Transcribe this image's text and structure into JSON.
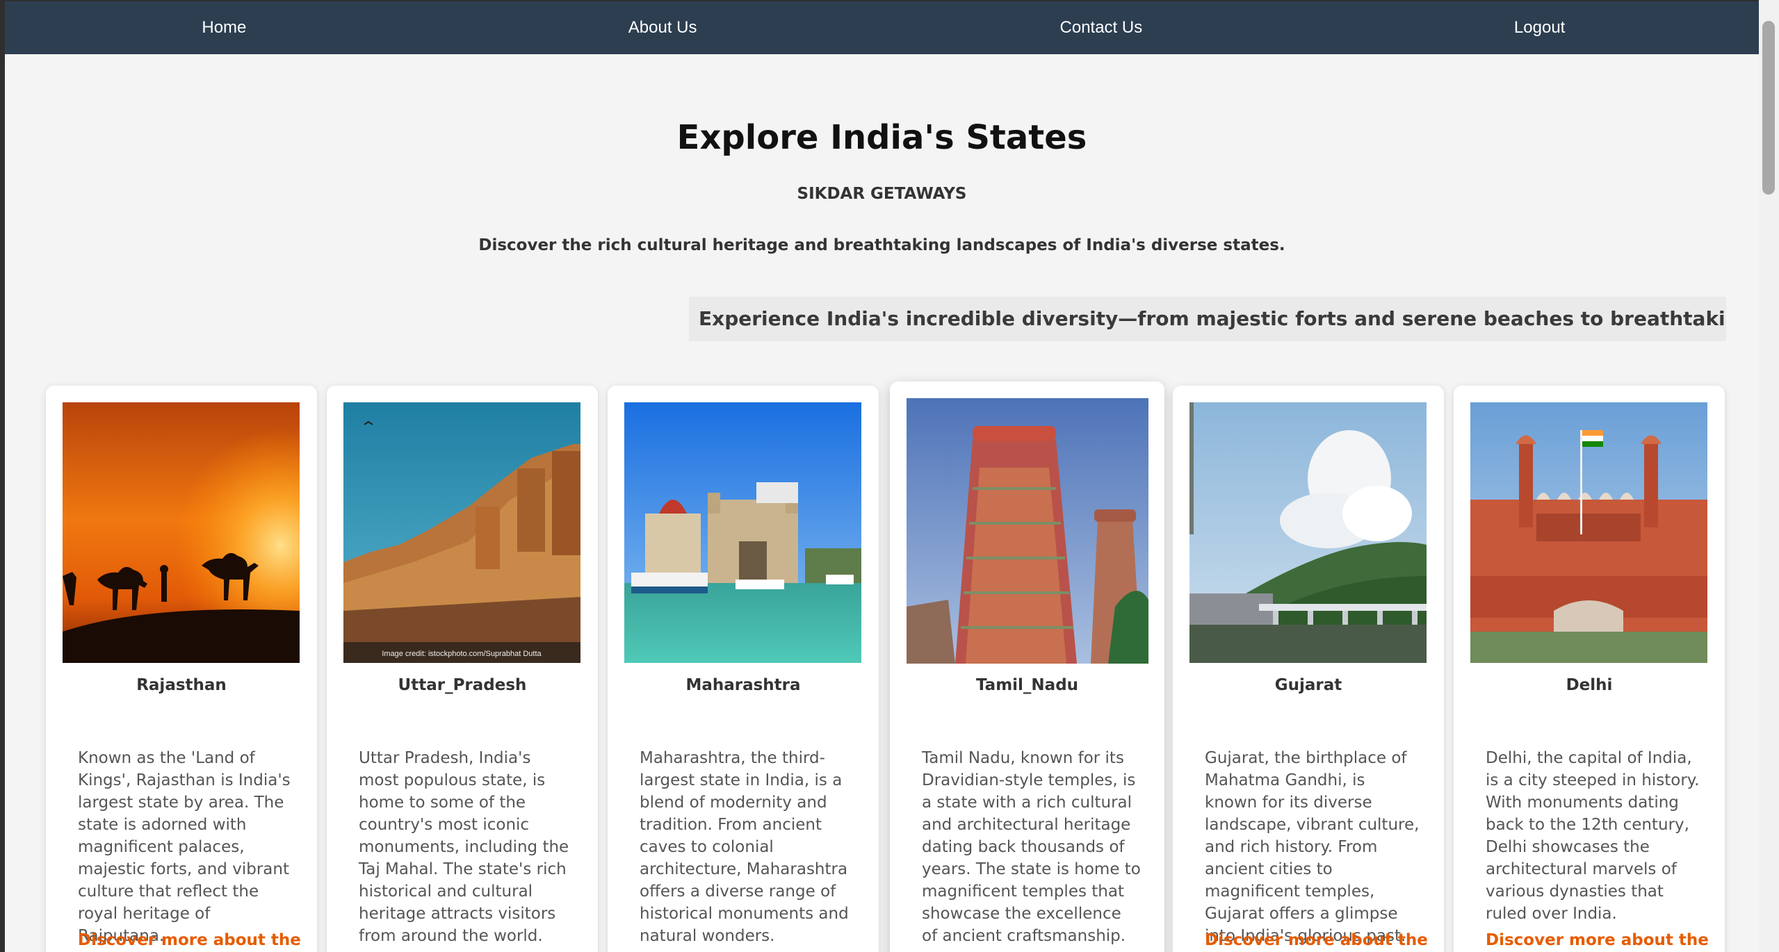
{
  "nav": [
    {
      "label": "Home"
    },
    {
      "label": "About Us"
    },
    {
      "label": "Contact Us"
    },
    {
      "label": "Logout"
    }
  ],
  "hero": {
    "title": "Explore India's States",
    "brand": "SIKDAR GETAWAYS",
    "tagline": "Discover the rich cultural heritage and breathtaking landscapes of India's diverse states."
  },
  "marquee": "Experience India's incredible diversity—from majestic forts and serene beaches to breathtaking mountains and vibra",
  "cards": [
    {
      "name": "Rajasthan",
      "description": "Known as the 'Land of Kings', Rajasthan is India's largest state by area. The state is adorned with magnificent palaces, majestic forts, and vibrant culture that reflect the royal heritage of Rajputana.",
      "link": "Discover more about the"
    },
    {
      "name": "Uttar_Pradesh",
      "description": "Uttar Pradesh, India's most populous state, is home to some of the country's most iconic monuments, including the Taj Mahal. The state's rich historical and cultural heritage attracts visitors from around the world.",
      "image_credit": "Image credit: istockphoto.com/Suprabhat Dutta",
      "link": ""
    },
    {
      "name": "Maharashtra",
      "description": "Maharashtra, the third-largest state in India, is a blend of modernity and tradition. From ancient caves to colonial architecture, Maharashtra offers a diverse range of historical monuments and natural wonders.",
      "link": ""
    },
    {
      "name": "Tamil_Nadu",
      "description": "Tamil Nadu, known for its Dravidian-style temples, is a state with a rich cultural and architectural heritage dating back thousands of years. The state is home to magnificent temples that showcase the excellence of ancient craftsmanship.",
      "link": ""
    },
    {
      "name": "Gujarat",
      "description": "Gujarat, the birthplace of Mahatma Gandhi, is known for its diverse landscape, vibrant culture, and rich history. From ancient cities to magnificent temples, Gujarat offers a glimpse into India's glorious past.",
      "link": "Discover more about the"
    },
    {
      "name": "Delhi",
      "description": "Delhi, the capital of India, is a city steeped in history. With monuments dating back to the 12th century, Delhi showcases the architectural marvels of various dynasties that ruled over India.",
      "link": "Discover more about the"
    }
  ],
  "colors": {
    "navbar": "#2c3e50",
    "link_accent": "#e65c00",
    "page_background": "#f4f4f4"
  }
}
